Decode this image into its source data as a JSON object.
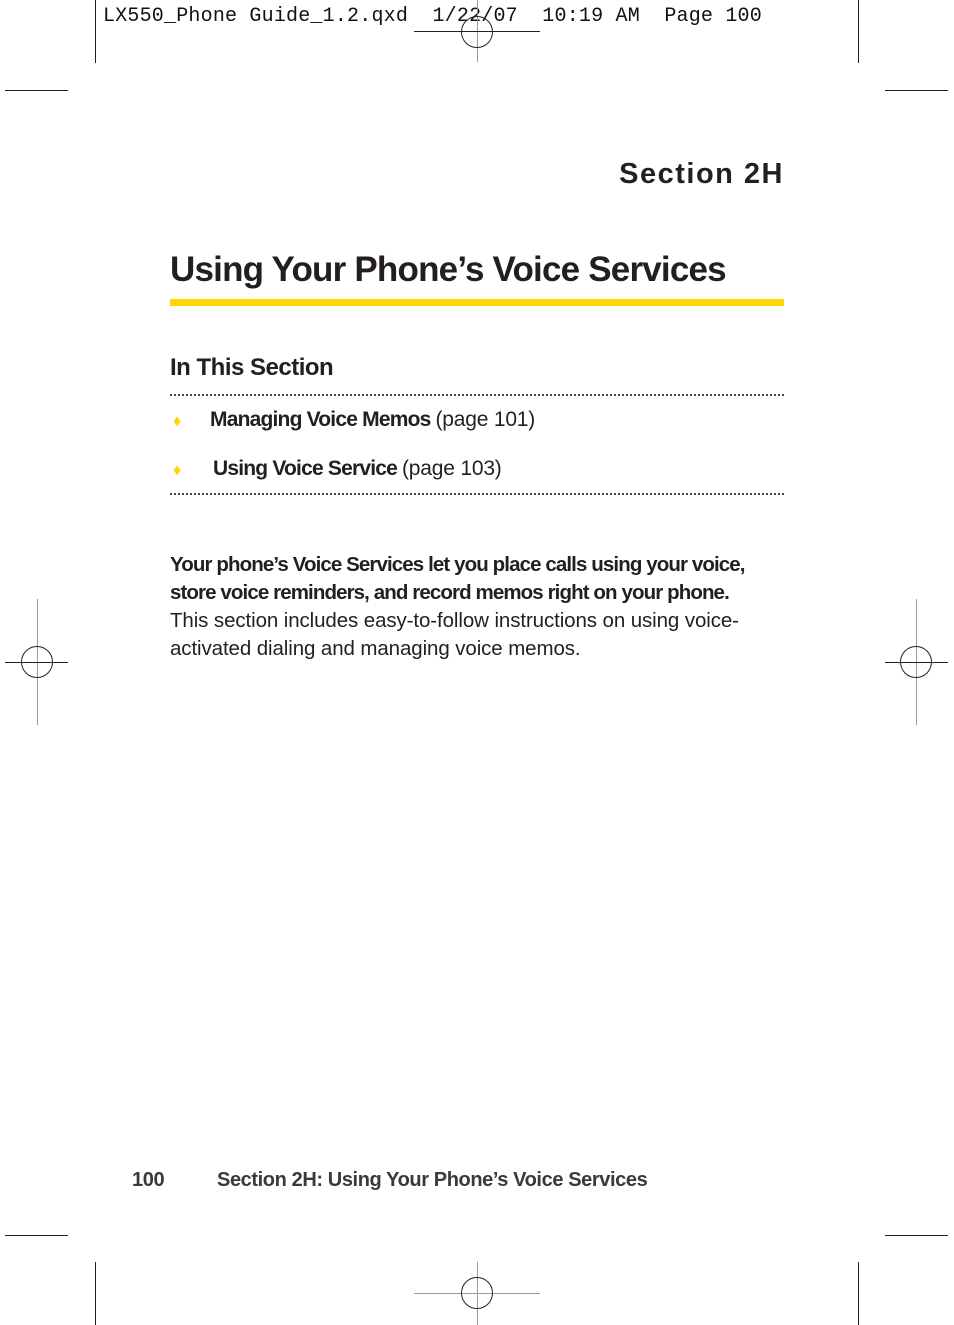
{
  "print_slug": {
    "file": "LX550_Phone Guide_1.2.qxd",
    "date": "1/22/07",
    "time": "10:19 AM",
    "page": "Page 100"
  },
  "header": {
    "section_label": "Section 2H"
  },
  "title": "Using Your Phone’s Voice Services",
  "colors": {
    "accent": "#ffd700",
    "text": "#231f20"
  },
  "in_this_section": {
    "heading": "In This Section",
    "bullet_icon": "♦",
    "items": [
      {
        "title": "Managing Voice Memos",
        "page_ref": "(page 101)"
      },
      {
        "title": "Using Voice Service",
        "page_ref": "(page 103)"
      }
    ]
  },
  "intro": {
    "lead": "Your phone’s Voice Services let you place calls using your voice, store voice reminders, and record memos right on your phone.",
    "rest": "This section includes easy-to-follow instructions on using voice-activated dialing and managing voice memos."
  },
  "footer": {
    "page_number": "100",
    "running_title": "Section 2H: Using Your Phone’s Voice Services"
  }
}
